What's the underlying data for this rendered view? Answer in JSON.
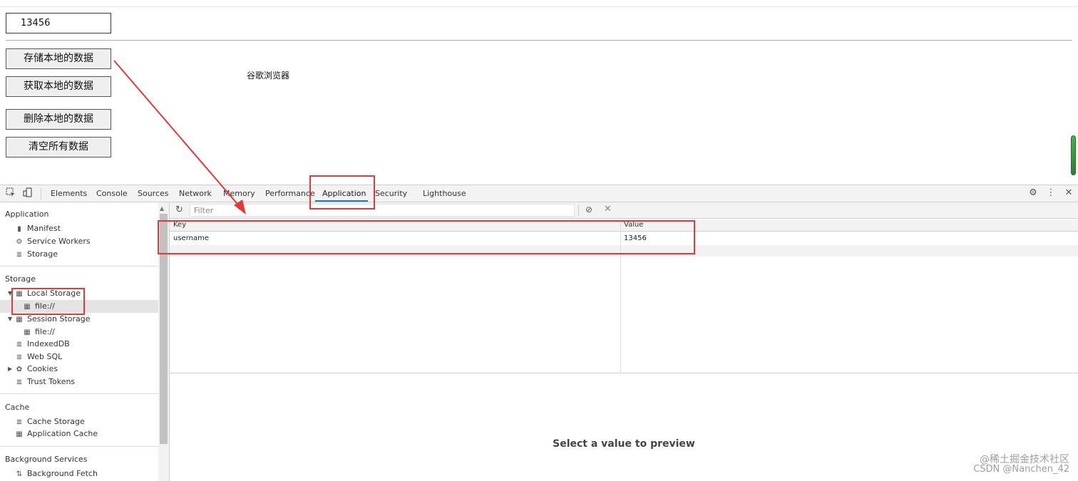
{
  "page": {
    "input_value": "13456",
    "buttons": [
      "存储本地的数据",
      "获取本地的数据",
      "删除本地的数据",
      "清空所有数据"
    ],
    "browser_label": "谷歌浏览器"
  },
  "devtools": {
    "tabs": [
      "Elements",
      "Console",
      "Sources",
      "Network",
      "Memory",
      "Performance",
      "Application",
      "Security",
      "Lighthouse"
    ],
    "active_tab": "Application",
    "sidebar": {
      "sections": {
        "application": "Application",
        "storage": "Storage",
        "cache": "Cache",
        "background": "Background Services"
      },
      "application_items": [
        "Manifest",
        "Service Workers",
        "Storage"
      ],
      "storage_items": {
        "local_storage": "Local Storage",
        "local_origin": "file://",
        "session_storage": "Session Storage",
        "session_origin": "file://",
        "indexeddb": "IndexedDB",
        "websql": "Web SQL",
        "cookies": "Cookies",
        "trust_tokens": "Trust Tokens"
      },
      "cache_items": [
        "Cache Storage",
        "Application Cache"
      ],
      "background_items": [
        "Background Fetch"
      ]
    },
    "filter_placeholder": "Filter",
    "table": {
      "headers": [
        "Key",
        "Value"
      ],
      "rows": [
        {
          "key": "username",
          "value": "13456"
        }
      ]
    },
    "preview_text": "Select a value to preview"
  },
  "annotation_color": "#e53935",
  "watermark": {
    "line1": "@稀土掘金技术社区",
    "line2": "CSDN @Nanchen_42"
  }
}
